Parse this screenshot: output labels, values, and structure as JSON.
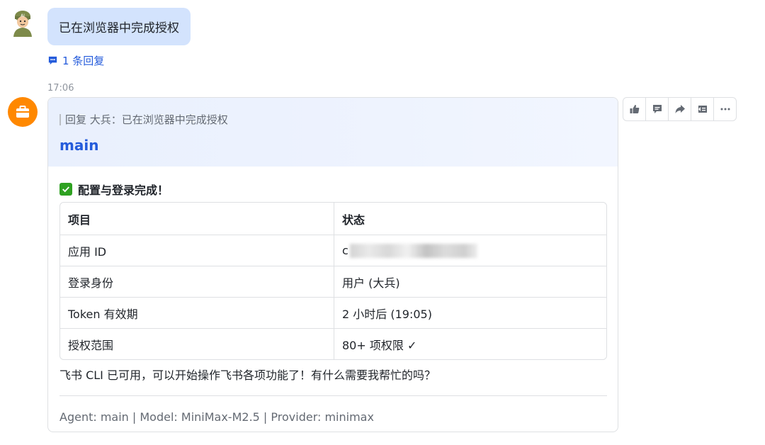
{
  "user_message": {
    "text": "已在浏览器中完成授权",
    "reply_count_label": "1 条回复"
  },
  "timestamp": "17:06",
  "bot_card": {
    "quote": "回复 大兵：已在浏览器中完成授权",
    "title": "main",
    "status_heading": "配置与登录完成！",
    "table": {
      "headers": [
        "项目",
        "状态"
      ],
      "rows": [
        [
          "应用 ID",
          "c"
        ],
        [
          "登录身份",
          "用户 (大兵)"
        ],
        [
          "Token 有效期",
          "2 小时后 (19:05)"
        ],
        [
          "授权范围",
          "80+ 项权限 ✓"
        ]
      ]
    },
    "message": "飞书 CLI 已可用，可以开始操作飞书各项功能了！有什么需要我帮忙的吗？",
    "footer": "Agent: main | Model: MiniMax-M2.5 | Provider: minimax"
  },
  "toolbar": {
    "icons": [
      "thumbs-up-icon",
      "comment-icon",
      "forward-icon",
      "pin-icon",
      "more-icon"
    ]
  },
  "colors": {
    "user_bubble": "#d3e3fd",
    "link_blue": "#245bdb",
    "bot_avatar": "#ff8800",
    "check_green": "#2ea121"
  }
}
